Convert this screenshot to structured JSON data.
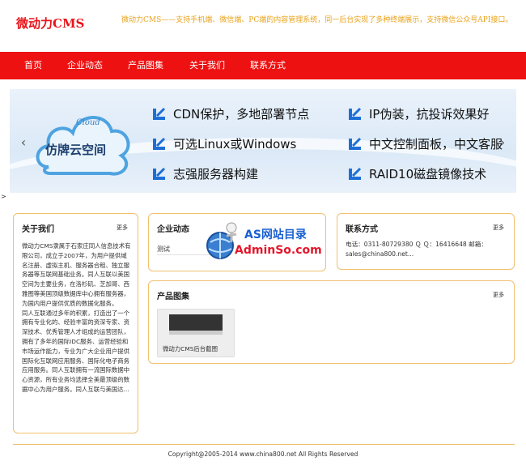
{
  "header": {
    "logo": "微动力CMS",
    "tagline": "微动力CMS——支持手机端、微信端、PC端的内容管理系统，同一后台实现了多种终端展示，支持微信公众号API接口。"
  },
  "nav": {
    "items": [
      "首页",
      "企业动态",
      "产品图集",
      "关于我们",
      "联系方式"
    ]
  },
  "banner": {
    "cloud_small": "Cloud",
    "cloud_big": "仿牌云空间",
    "features": [
      "CDN保护，多地部署节点",
      "可选Linux或Windows",
      "志强服务器构建",
      "IP伪装，抗投诉效果好",
      "中文控制面板，中文客服",
      "RAID10磁盘镜像技术"
    ],
    "prev_icon": "chevron-left-icon",
    "next_icon": "chevron-right-icon"
  },
  "stray_mark": ">",
  "about": {
    "title": "关于我们",
    "more": "更多",
    "text": "微动力CMS隶属于石家庄同人信息技术有限公司，成立于2007年，为用户提供域名注册、虚拟主机、服务器合租、独立服务器等互联网基础业务。同人互联以美国空间为主要业务，在洛杉矶、芝加哥、西雅图等美国顶级数据库中心拥有服务器，为国内用户提供优质的数据化服务。　　同人互联通过多年的积累，打造出了一个拥有专业化的、经验丰富的资深专家、资深技术、优秀管理人才组成的运营团队，拥有了多年的国际IDC服务、运营经验和市场运作能力，专业为广大企业用户提供国际化互联网应用服务、国际化电子商务应用服务。同人互联拥有一流国际数据中心资源，所有业务均选择全美最顶级的数据中心为用户服务。同人互联与美国达..."
  },
  "news": {
    "title": "企业动态",
    "items": [
      "测试"
    ]
  },
  "contact": {
    "title": "联系方式",
    "more": "更多",
    "text": "电话：0311-80729380 Ｑ Ｑ：16416648 邮箱：sales@china800.net..."
  },
  "products": {
    "title": "产品图集",
    "more": "更多",
    "items": [
      "微动力CMS后台截图"
    ]
  },
  "watermark": {
    "top": "AS网站目录",
    "bottom": "AdminSo.com"
  },
  "footer": {
    "text": "Copyright@2005-2014 www.china800.net All Rights Reserved"
  },
  "colors": {
    "nav_bg": "#ee1111",
    "logo": "#e8141a",
    "tagline": "#e8a21a",
    "box_border": "#f0c070",
    "feature_check": "#1d6fd6"
  }
}
